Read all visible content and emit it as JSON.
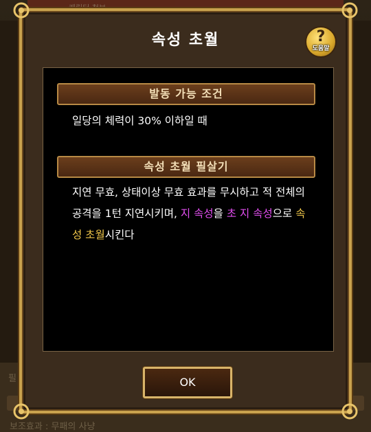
{
  "background": {
    "top_text": "캐릭터 첫보",
    "bottom_ghost_1": "필",
    "bottom_ghost_2": "보조효과 : 무패의 사냥"
  },
  "popup": {
    "title": "속성 초월",
    "help_label": "도움말",
    "help_glyph": "?",
    "ok_label": "OK"
  },
  "sections": {
    "condition_header": "발동 가능 조건",
    "condition_text": "일당의 체력이 30% 이하일 때",
    "skill_header": "속성 초월 필살기",
    "skill_text": {
      "p1": "지연 무효, 상태이상 무효 효과를 무시하고 적 전체의 공격을 1턴 지연시키며, ",
      "p2": "지 속성",
      "p3": "을 ",
      "p4": "초 지 속성",
      "p5": "으로 ",
      "p6": "속성 초월",
      "p7": "시킨다"
    }
  },
  "colors": {
    "frame_gold": "#c9a24e",
    "highlight_purple": "#e24ef0",
    "highlight_gold": "#f2c84a"
  }
}
